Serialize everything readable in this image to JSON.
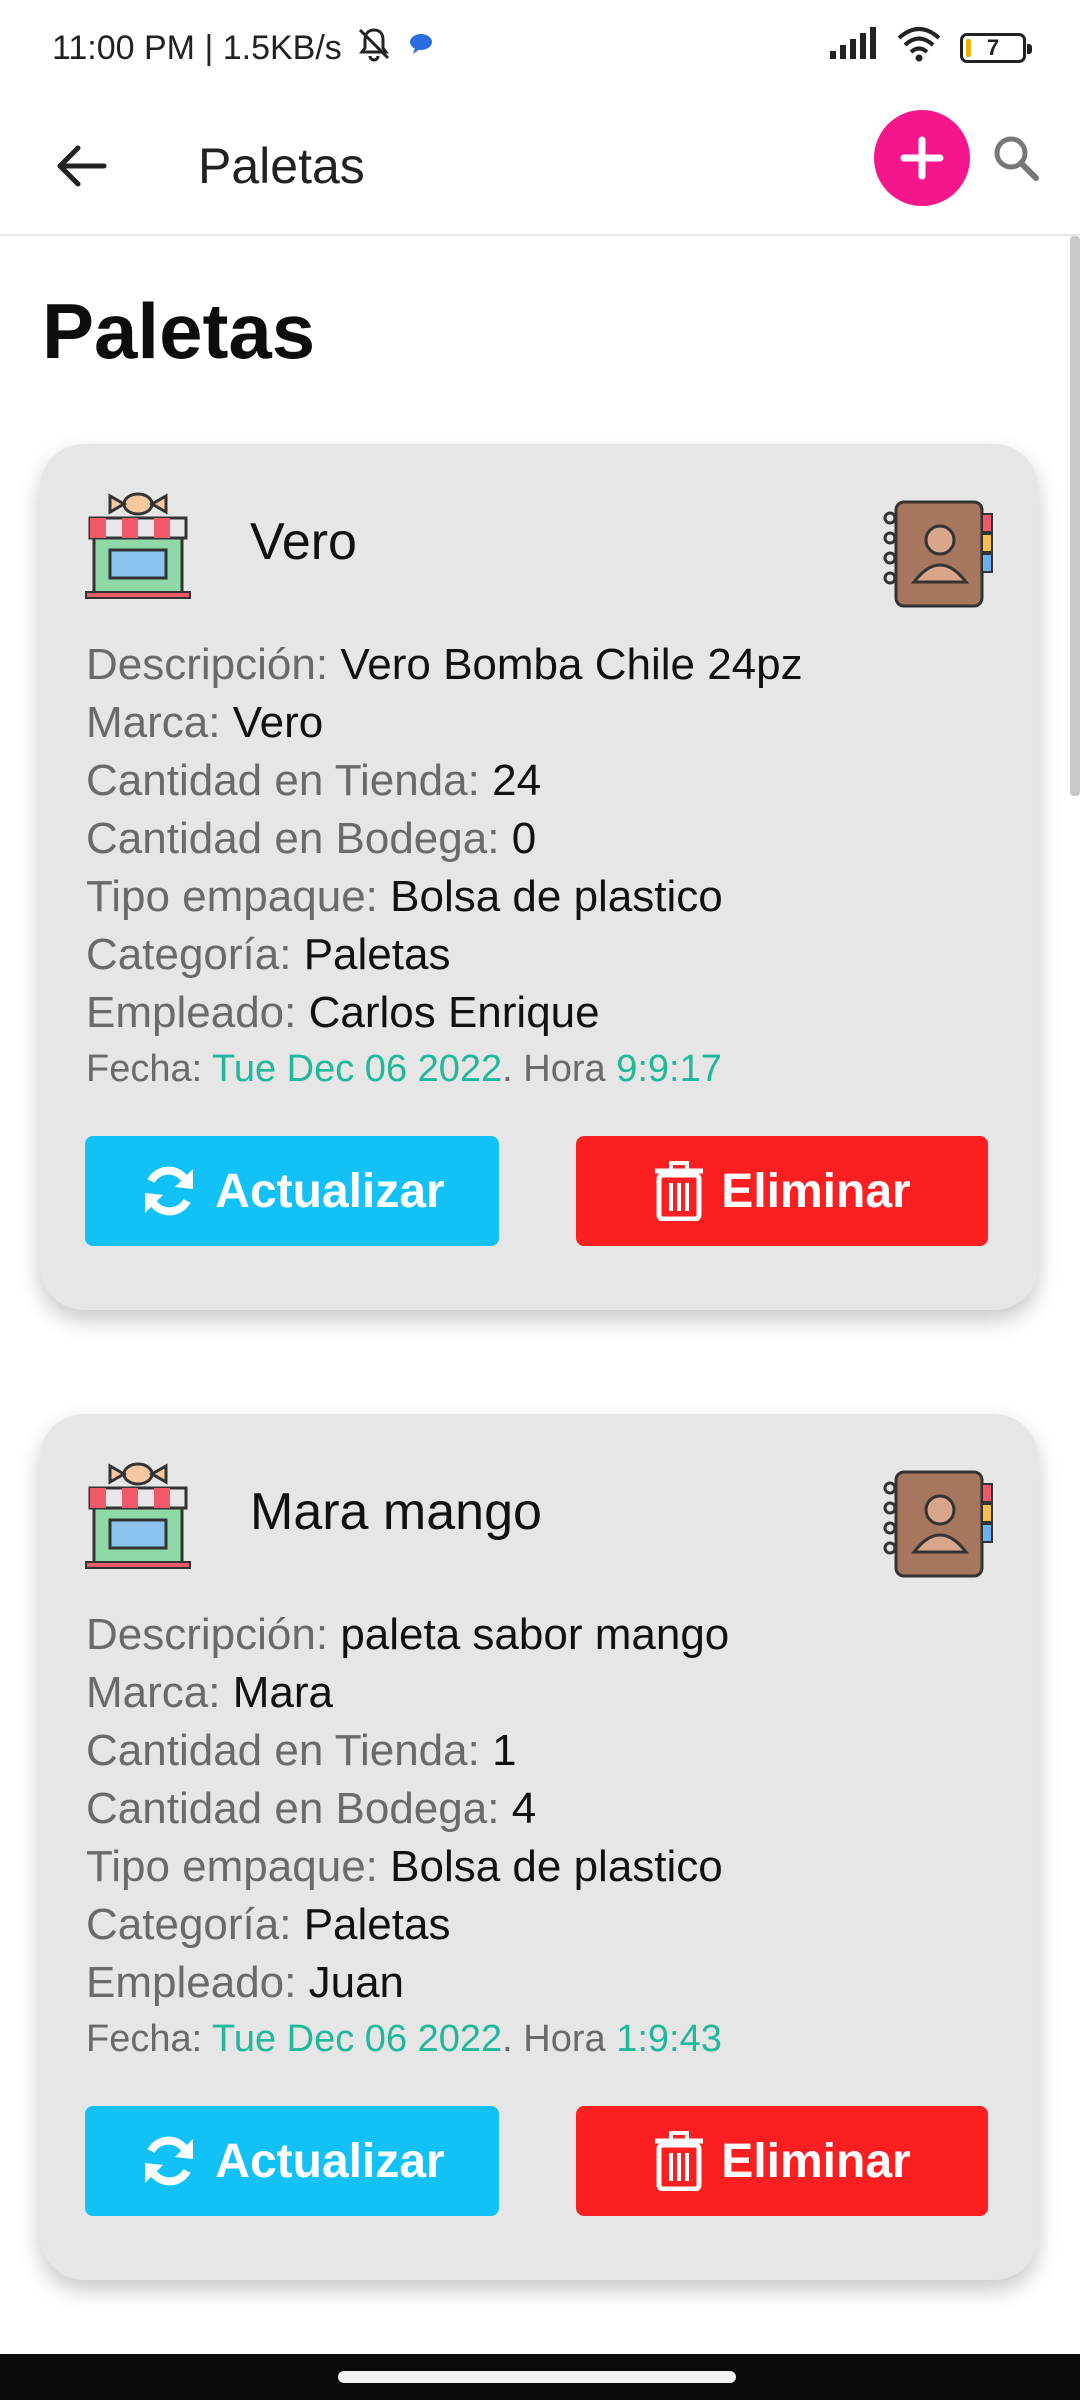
{
  "status_bar": {
    "time_speed": "11:00 PM | 1.5KB/s",
    "battery_level": "7"
  },
  "app_bar": {
    "title": "Paletas"
  },
  "page": {
    "heading": "Paletas"
  },
  "colors": {
    "accent_pink": "#f5168c",
    "update_blue": "#12c1f5",
    "delete_red": "#fb1f22",
    "time_green": "#1fb89a"
  },
  "products": [
    {
      "name": "Vero",
      "descripcion_label": "Descripción:",
      "descripcion": "Vero Bomba Chile 24pz",
      "marca_label": "Marca:",
      "marca": "Vero",
      "tienda_label": "Cantidad en Tienda:",
      "tienda": "24",
      "bodega_label": "Cantidad en Bodega:",
      "bodega": "0",
      "empaque_label": "Tipo empaque:",
      "empaque": "Bolsa de plastico",
      "categoria_label": "Categoría:",
      "categoria": "Paletas",
      "empleado_label": "Empleado:",
      "empleado": "Carlos Enrique",
      "fecha_label": "Fecha:",
      "fecha": "Tue Dec 06 2022",
      "hora_label": ". Hora",
      "hora": "9:9:17",
      "update_label": "Actualizar",
      "delete_label": "Eliminar"
    },
    {
      "name": "Mara mango",
      "descripcion_label": "Descripción:",
      "descripcion": "paleta sabor mango",
      "marca_label": "Marca:",
      "marca": "Mara",
      "tienda_label": "Cantidad en Tienda:",
      "tienda": "1",
      "bodega_label": "Cantidad en Bodega:",
      "bodega": "4",
      "empaque_label": "Tipo empaque:",
      "empaque": "Bolsa de plastico",
      "categoria_label": "Categoría:",
      "categoria": "Paletas",
      "empleado_label": "Empleado:",
      "empleado": "Juan",
      "fecha_label": "Fecha:",
      "fecha": "Tue Dec 06 2022",
      "hora_label": ". Hora",
      "hora": "1:9:43",
      "update_label": "Actualizar",
      "delete_label": "Eliminar"
    }
  ]
}
